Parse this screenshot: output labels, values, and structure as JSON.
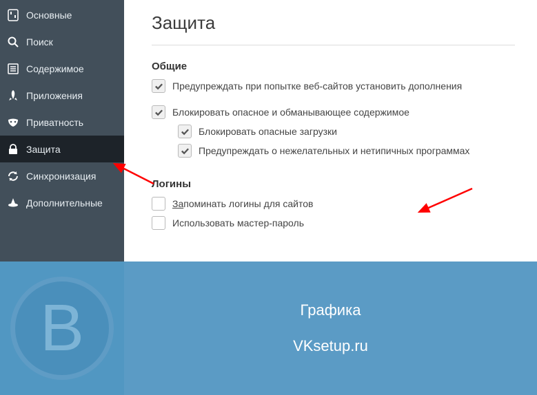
{
  "sidebar": {
    "items": [
      {
        "label": "Основные"
      },
      {
        "label": "Поиск"
      },
      {
        "label": "Содержимое"
      },
      {
        "label": "Приложения"
      },
      {
        "label": "Приватность"
      },
      {
        "label": "Защита"
      },
      {
        "label": "Синхронизация"
      },
      {
        "label": "Дополнительные"
      }
    ]
  },
  "main": {
    "title": "Защита",
    "general_section": "Общие",
    "opt_warn_addons": "Предупреждать при попытке веб-сайтов установить дополнения",
    "opt_block_dangerous": "Блокировать опасное и обманывающее содержимое",
    "opt_block_downloads": "Блокировать опасные загрузки",
    "opt_warn_programs": "Предупреждать о нежелательных и нетипичных программах",
    "logins_section": "Логины",
    "opt_remember_logins_prefix": "За",
    "opt_remember_logins_rest": "поминать логины для сайтов",
    "opt_master_password": "Использовать мастер-пароль"
  },
  "banner": {
    "letter": "В",
    "line1": "Графика",
    "line2": "VKsetup.ru"
  }
}
